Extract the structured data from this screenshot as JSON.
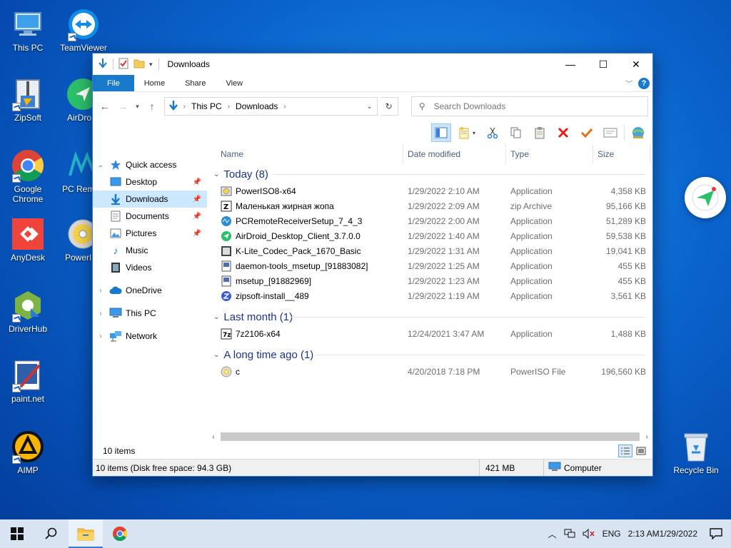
{
  "desktop": {
    "icons": [
      {
        "label": "This PC"
      },
      {
        "label": "TeamViewer"
      },
      {
        "label": "ZipSoft"
      },
      {
        "label": "AirDro"
      },
      {
        "label": "Google Chrome"
      },
      {
        "label": "PC Remo Receiv"
      },
      {
        "label": "AnyDesk"
      },
      {
        "label": "PowerIS"
      },
      {
        "label": "DriverHub"
      },
      {
        "label": "paint.net"
      },
      {
        "label": "AIMP"
      },
      {
        "label": "Recycle Bin"
      }
    ]
  },
  "window": {
    "title": "Downloads",
    "controls": {
      "minimize": "—",
      "maximize": "☐",
      "close": "✕"
    },
    "ribbon_tabs": [
      "File",
      "Home",
      "Share",
      "View"
    ],
    "help_label": "?",
    "breadcrumb": [
      "This PC",
      "Downloads"
    ],
    "search_placeholder": "Search Downloads",
    "columns": {
      "name": "Name",
      "date": "Date modified",
      "type": "Type",
      "size": "Size"
    },
    "nav": {
      "quick_access": "Quick access",
      "items": [
        "Desktop",
        "Downloads",
        "Documents",
        "Pictures",
        "Music",
        "Videos"
      ],
      "onedrive": "OneDrive",
      "thispc": "This PC",
      "network": "Network"
    },
    "groups": [
      {
        "label": "Today (8)",
        "files": [
          {
            "name": "PowerISO8-x64",
            "date": "1/29/2022 2:10 AM",
            "type": "Application",
            "size": "4,358 KB"
          },
          {
            "name": "Маленькая жирная жопа",
            "date": "1/29/2022 2:09 AM",
            "type": "zip Archive",
            "size": "95,166 KB"
          },
          {
            "name": "PCRemoteReceiverSetup_7_4_3",
            "date": "1/29/2022 2:00 AM",
            "type": "Application",
            "size": "51,289 KB"
          },
          {
            "name": "AirDroid_Desktop_Client_3.7.0.0",
            "date": "1/29/2022 1:40 AM",
            "type": "Application",
            "size": "59,538 KB"
          },
          {
            "name": "K-Lite_Codec_Pack_1670_Basic",
            "date": "1/29/2022 1:31 AM",
            "type": "Application",
            "size": "19,041 KB"
          },
          {
            "name": "daemon-tools_msetup_[91883082]",
            "date": "1/29/2022 1:25 AM",
            "type": "Application",
            "size": "455 KB"
          },
          {
            "name": "msetup_[91882969]",
            "date": "1/29/2022 1:23 AM",
            "type": "Application",
            "size": "455 KB"
          },
          {
            "name": "zipsoft-install__489",
            "date": "1/29/2022 1:19 AM",
            "type": "Application",
            "size": "3,561 KB"
          }
        ]
      },
      {
        "label": "Last month (1)",
        "files": [
          {
            "name": "7z2106-x64",
            "date": "12/24/2021 3:47 AM",
            "type": "Application",
            "size": "1,488 KB"
          }
        ]
      },
      {
        "label": "A long time ago (1)",
        "files": [
          {
            "name": "c",
            "date": "4/20/2018 7:18 PM",
            "type": "PowerISO File",
            "size": "196,560 KB"
          }
        ]
      }
    ],
    "item_count": "10 items",
    "status_left": "10 items (Disk free space: 94.3 GB)",
    "status_size": "421 MB",
    "status_location": "Computer"
  },
  "taskbar": {
    "lang": "ENG",
    "time": "2:13 AM",
    "date": "1/29/2022"
  },
  "colors": {
    "accent": "#1979ca",
    "group_header": "#1e3287",
    "selection": "#cce8ff"
  }
}
